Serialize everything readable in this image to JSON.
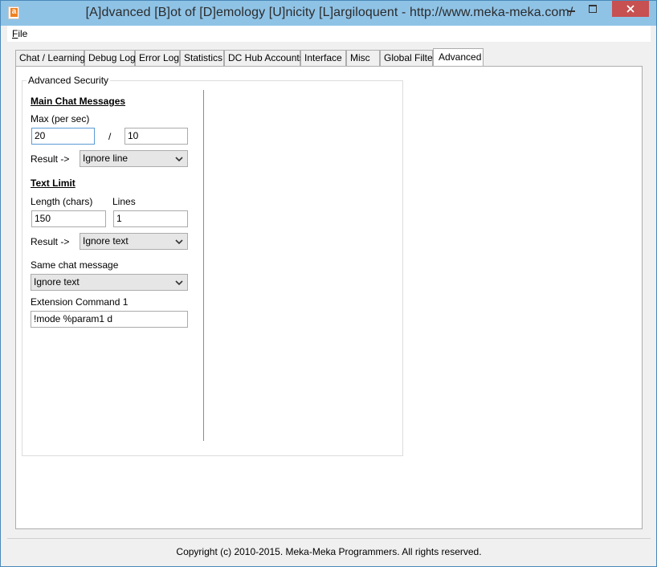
{
  "window": {
    "title": "[A]dvanced [B]ot of [D]emology [U]nicity [L]argiloquent - http://www.meka-meka.com/",
    "icon_letter": "a",
    "colors": {
      "titlebar": "#8fc3e6",
      "close": "#c75050"
    }
  },
  "menu": {
    "file_label": "File"
  },
  "tabs": [
    {
      "label": "Chat / Learning"
    },
    {
      "label": "Debug Log"
    },
    {
      "label": "Error Log"
    },
    {
      "label": "Statistics"
    },
    {
      "label": "DC Hub Accounts"
    },
    {
      "label": "Interface"
    },
    {
      "label": "Misc"
    },
    {
      "label": "Global Filter"
    },
    {
      "label": "Advanced",
      "active": true
    }
  ],
  "advanced": {
    "group_title": "Advanced Security",
    "main_chat": {
      "header": "Main Chat Messages",
      "max_label": "Max (per sec)",
      "max_value": "20",
      "separator": "/",
      "per_value": "10",
      "result_label": "Result ->",
      "result_value": "Ignore line"
    },
    "text_limit": {
      "header": "Text Limit",
      "length_label": "Length (chars)",
      "lines_label": "Lines",
      "length_value": "150",
      "lines_value": "1",
      "result_label": "Result ->",
      "result_value": "Ignore text"
    },
    "same_chat": {
      "label": "Same chat message",
      "value": "Ignore text"
    },
    "extension": {
      "label": "Extension Command 1",
      "value": "!mode %param1 d"
    }
  },
  "status": {
    "copyright": "Copyright (c) 2010-2015. Meka-Meka Programmers. All rights reserved."
  }
}
